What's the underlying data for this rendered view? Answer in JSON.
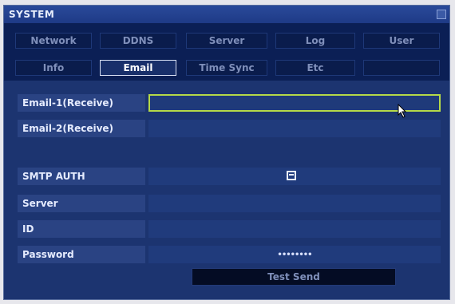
{
  "window": {
    "title": "SYSTEM"
  },
  "tabs": {
    "row1": [
      "Network",
      "DDNS",
      "Server",
      "Log",
      "User"
    ],
    "row2": [
      "Info",
      "Email",
      "Time Sync",
      "Etc",
      ""
    ],
    "active": "Email"
  },
  "form": {
    "email1_label": "Email-1(Receive)",
    "email1_value": "",
    "email2_label": "Email-2(Receive)",
    "email2_value": "",
    "smtp_auth_label": "SMTP AUTH",
    "smtp_auth_checked": false,
    "server_label": "Server",
    "server_value": "",
    "id_label": "ID",
    "id_value": "",
    "password_label": "Password",
    "password_mask": "••••••••",
    "test_send_label": "Test Send"
  },
  "icons": {
    "close": "close-icon",
    "checkbox": "checkbox-icon",
    "cursor": "mouse-pointer-icon"
  },
  "colors": {
    "window_bg": "#1c3470",
    "tab_strip_bg": "#0b1f55",
    "focus_border": "#b5d948"
  }
}
